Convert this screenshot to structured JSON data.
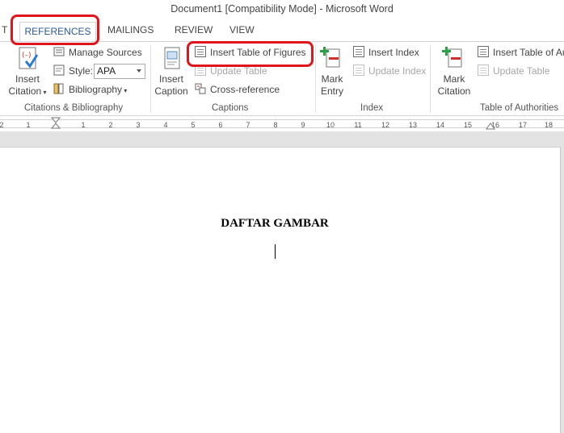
{
  "window": {
    "title": "Document1 [Compatibility Mode] - Microsoft Word"
  },
  "tabs": [
    {
      "label": "T"
    },
    {
      "label": "REFERENCES"
    },
    {
      "label": "MAILINGS"
    },
    {
      "label": "REVIEW"
    },
    {
      "label": "VIEW"
    }
  ],
  "ribbon": {
    "citations": {
      "insert_citation": "Insert",
      "insert_citation_2": "Citation",
      "manage_sources": "Manage Sources",
      "style_label": "Style:",
      "style_value": "APA",
      "bibliography": "Bibliography",
      "group_label": "Citations & Bibliography"
    },
    "captions": {
      "insert_caption": "Insert",
      "insert_caption_2": "Caption",
      "insert_table_of_figures": "Insert Table of Figures",
      "update_table": "Update Table",
      "cross_reference": "Cross-reference",
      "group_label": "Captions"
    },
    "index": {
      "mark_entry": "Mark",
      "mark_entry_2": "Entry",
      "insert_index": "Insert Index",
      "update_index": "Update Index",
      "group_label": "Index"
    },
    "authorities": {
      "mark_citation": "Mark",
      "mark_citation_2": "Citation",
      "insert_table_of_authorities": "Insert Table of Au",
      "update_table": "Update Table",
      "group_label": "Table of Authorities"
    }
  },
  "ruler": {
    "numbers": [
      "2",
      "1",
      "1",
      "2",
      "3",
      "4",
      "5",
      "6",
      "7",
      "8",
      "9",
      "10",
      "11",
      "12",
      "13",
      "14",
      "15",
      "16",
      "17",
      "18"
    ]
  },
  "document": {
    "heading": "DAFTAR GAMBAR"
  },
  "colors": {
    "accent": "#2b579a",
    "highlight": "#e0141b",
    "ruler_bg": "#ffffff",
    "canvas": "#e3e3e3"
  }
}
